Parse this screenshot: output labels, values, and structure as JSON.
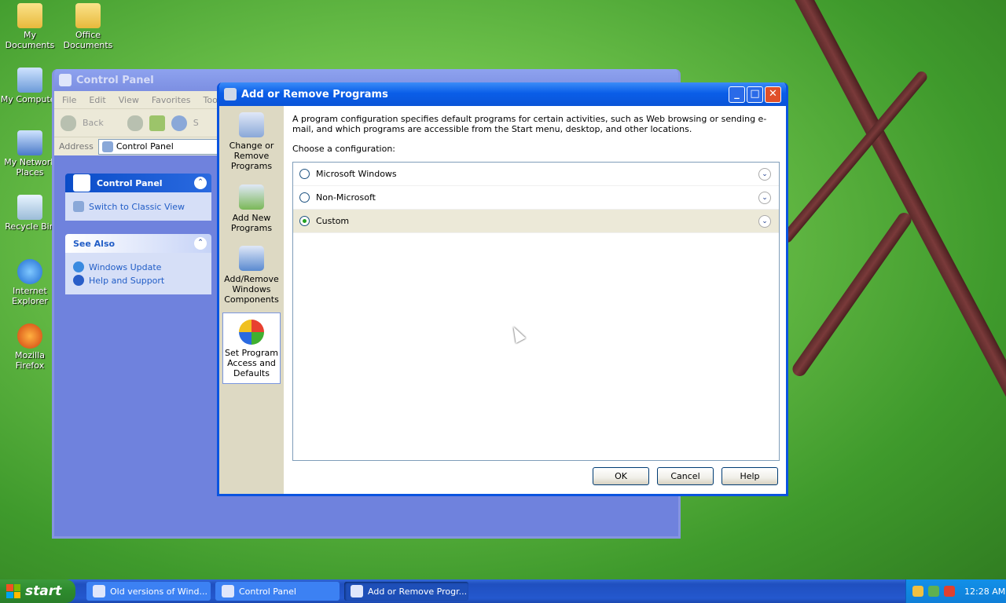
{
  "desktop": {
    "icons": [
      {
        "label": "My Documents",
        "icon": "my-documents-icon"
      },
      {
        "label": "Office Documents",
        "icon": "folder-icon"
      },
      {
        "label": "My Computer",
        "icon": "my-computer-icon"
      },
      {
        "label": "My Network Places",
        "icon": "network-icon"
      },
      {
        "label": "Recycle Bin",
        "icon": "recycle-bin-icon"
      },
      {
        "label": "Internet Explorer",
        "icon": "ie-icon"
      },
      {
        "label": "Mozilla Firefox",
        "icon": "firefox-icon"
      }
    ]
  },
  "control_panel": {
    "title": "Control Panel",
    "menu": [
      "File",
      "Edit",
      "View",
      "Favorites",
      "Tools"
    ],
    "toolbar": {
      "back": "Back",
      "search_fragment": "S"
    },
    "address_label": "Address",
    "address_value": "Control Panel",
    "pane_main": {
      "title": "Control Panel",
      "link": "Switch to Classic View"
    },
    "pane_see_also": {
      "title": "See Also",
      "links": [
        "Windows Update",
        "Help and Support"
      ]
    }
  },
  "arp": {
    "title": "Add or Remove Programs",
    "sidebar": [
      {
        "label": "Change or Remove Programs",
        "icon": "change-remove-icon"
      },
      {
        "label": "Add New Programs",
        "icon": "add-new-icon"
      },
      {
        "label": "Add/Remove Windows Components",
        "icon": "components-icon"
      },
      {
        "label": "Set Program Access and Defaults",
        "icon": "defaults-icon"
      }
    ],
    "description": "A program configuration specifies default programs for certain activities, such as Web browsing or sending e-mail, and which programs are accessible from the Start menu, desktop, and other locations.",
    "choose_label": "Choose a configuration:",
    "configs": [
      {
        "label": "Microsoft Windows",
        "checked": false
      },
      {
        "label": "Non-Microsoft",
        "checked": false
      },
      {
        "label": "Custom",
        "checked": true
      }
    ],
    "buttons": {
      "ok": "OK",
      "cancel": "Cancel",
      "help": "Help"
    }
  },
  "taskbar": {
    "start_label": "start",
    "tasks": [
      "Old versions of Wind...",
      "Control Panel",
      "Add or Remove Progr..."
    ],
    "clock": "12:28 AM"
  },
  "colors": {
    "accent": "#0a54e0",
    "start": "#2d8a2d",
    "taskbar": "#245edb"
  }
}
